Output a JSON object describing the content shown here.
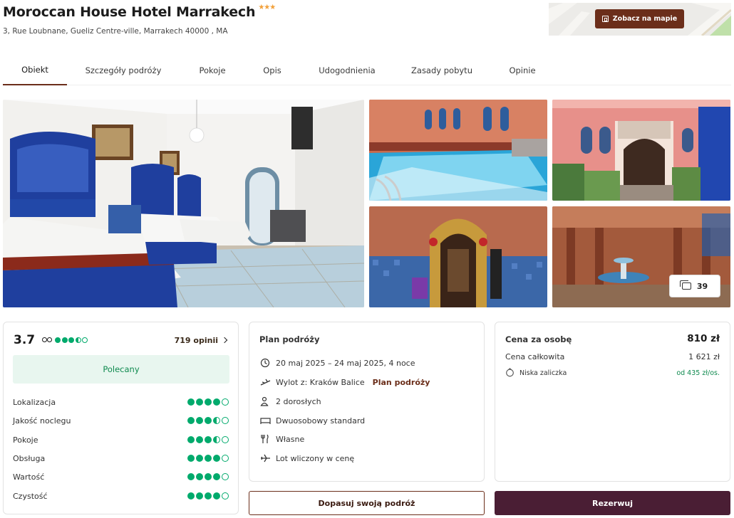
{
  "hotel": {
    "name": "Moroccan House Hotel Marrakech",
    "stars": "★★★",
    "address": "3, Rue Loubnane, Gueliz Centre-ville, Marrakech 40000 , MA"
  },
  "map": {
    "button_label": "Zobacz na mapie"
  },
  "tabs": [
    {
      "label": "Obiekt",
      "active": true
    },
    {
      "label": "Szczegóły podróży"
    },
    {
      "label": "Pokoje"
    },
    {
      "label": "Opis"
    },
    {
      "label": "Udogodnienia"
    },
    {
      "label": "Zasady pobytu"
    },
    {
      "label": "Opinie"
    }
  ],
  "gallery": {
    "photo_count": "39"
  },
  "rating": {
    "score": "3.7",
    "score_dots": 3.5,
    "reviews_label": "719 opinii",
    "badge": "Polecany",
    "categories": [
      {
        "label": "Lokalizacja",
        "value": 4
      },
      {
        "label": "Jakość noclegu",
        "value": 3.5
      },
      {
        "label": "Pokoje",
        "value": 3.5
      },
      {
        "label": "Obsługa",
        "value": 4
      },
      {
        "label": "Wartość",
        "value": 4
      },
      {
        "label": "Czystość",
        "value": 4
      }
    ]
  },
  "plan": {
    "title": "Plan podróży",
    "dates": "20 maj 2025 – 24 maj 2025, 4 noce",
    "departure": "Wylot z: Kraków Balice",
    "departure_link": "Plan podróży",
    "guests": "2 dorosłych",
    "room": "Dwuosobowy standard",
    "board": "Własne",
    "flight": "Lot wliczony w cenę"
  },
  "price": {
    "per_person_label": "Cena za osobę",
    "per_person_value": "810 zł",
    "total_label": "Cena całkowita",
    "total_value": "1 621 zł",
    "deposit_label": "Niska zaliczka",
    "deposit_value": "od 435 zł/os."
  },
  "actions": {
    "customize_label": "Dopasuj swoją podróż",
    "book_label": "Rezerwuj"
  },
  "colors": {
    "brand": "#6b2e1a",
    "book_button": "#4a1e34",
    "rating_green": "#00aa6c",
    "star_orange": "#f2a03a"
  }
}
